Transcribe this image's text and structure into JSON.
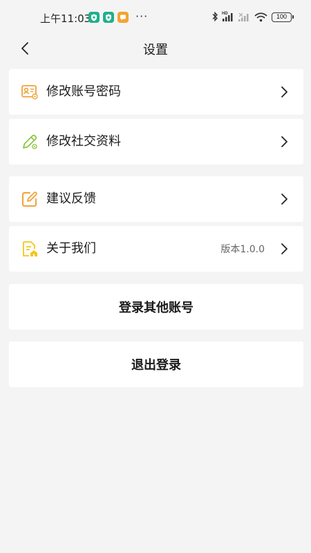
{
  "status_bar": {
    "time": "上午11:03",
    "more": "···",
    "battery": "100",
    "app_icons": [
      "shield-app-icon",
      "shield-app-icon",
      "message-app-icon"
    ],
    "colors": {
      "app_green": "#1fb08c",
      "app_orange": "#f2a431"
    }
  },
  "header": {
    "title": "设置",
    "back_icon": "chevron-left-icon"
  },
  "settings": {
    "group1": [
      {
        "label": "修改账号密码",
        "icon": "id-card-icon"
      },
      {
        "label": "修改社交资料",
        "icon": "pencil-icon"
      }
    ],
    "group2": [
      {
        "label": "建议反馈",
        "icon": "edit-note-icon"
      },
      {
        "label": "关于我们",
        "icon": "document-home-icon",
        "value": "版本1.0.0"
      }
    ]
  },
  "actions": {
    "switch_account": "登录其他账号",
    "logout": "退出登录"
  },
  "colors": {
    "background": "#f4f4f4",
    "card": "#ffffff",
    "icon_orange": "#f0a33a",
    "icon_green": "#8dc63f",
    "icon_yellow": "#f5c518"
  }
}
